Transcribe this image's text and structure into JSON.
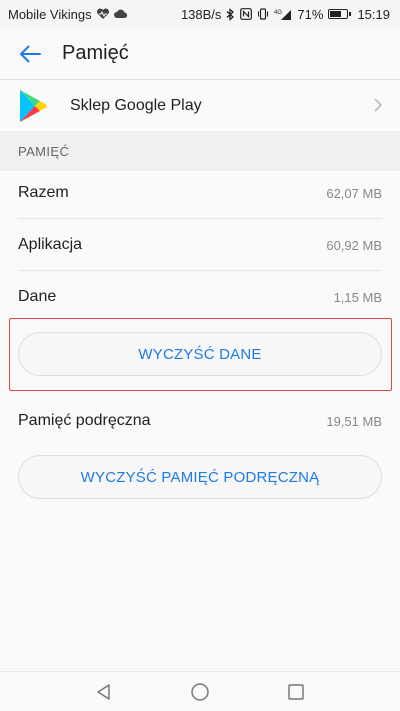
{
  "status_bar": {
    "carrier": "Mobile Vikings",
    "network_speed": "138B/s",
    "network_type": "4G",
    "battery_percent": "71%",
    "battery_level": 0.71,
    "time": "15:19"
  },
  "app_bar": {
    "title": "Pamięć",
    "back_icon": "arrow-left-icon"
  },
  "app_entry": {
    "name": "Sklep Google Play",
    "icon": "google-play-icon"
  },
  "storage_section": {
    "header": "PAMIĘĆ",
    "rows": [
      {
        "label": "Razem",
        "value": "62,07 MB"
      },
      {
        "label": "Aplikacja",
        "value": "60,92 MB"
      },
      {
        "label": "Dane",
        "value": "1,15 MB"
      }
    ],
    "clear_data_button": "WYCZYŚĆ DANE"
  },
  "cache_section": {
    "label": "Pamięć podręczna",
    "value": "19,51 MB",
    "clear_cache_button": "WYCZYŚĆ PAMIĘĆ PODRĘCZNĄ"
  },
  "colors": {
    "accent": "#1e7be6",
    "highlight": "#e0474b"
  },
  "nav_bar": {
    "icons": [
      "back-triangle-icon",
      "home-circle-icon",
      "recents-square-icon"
    ]
  }
}
